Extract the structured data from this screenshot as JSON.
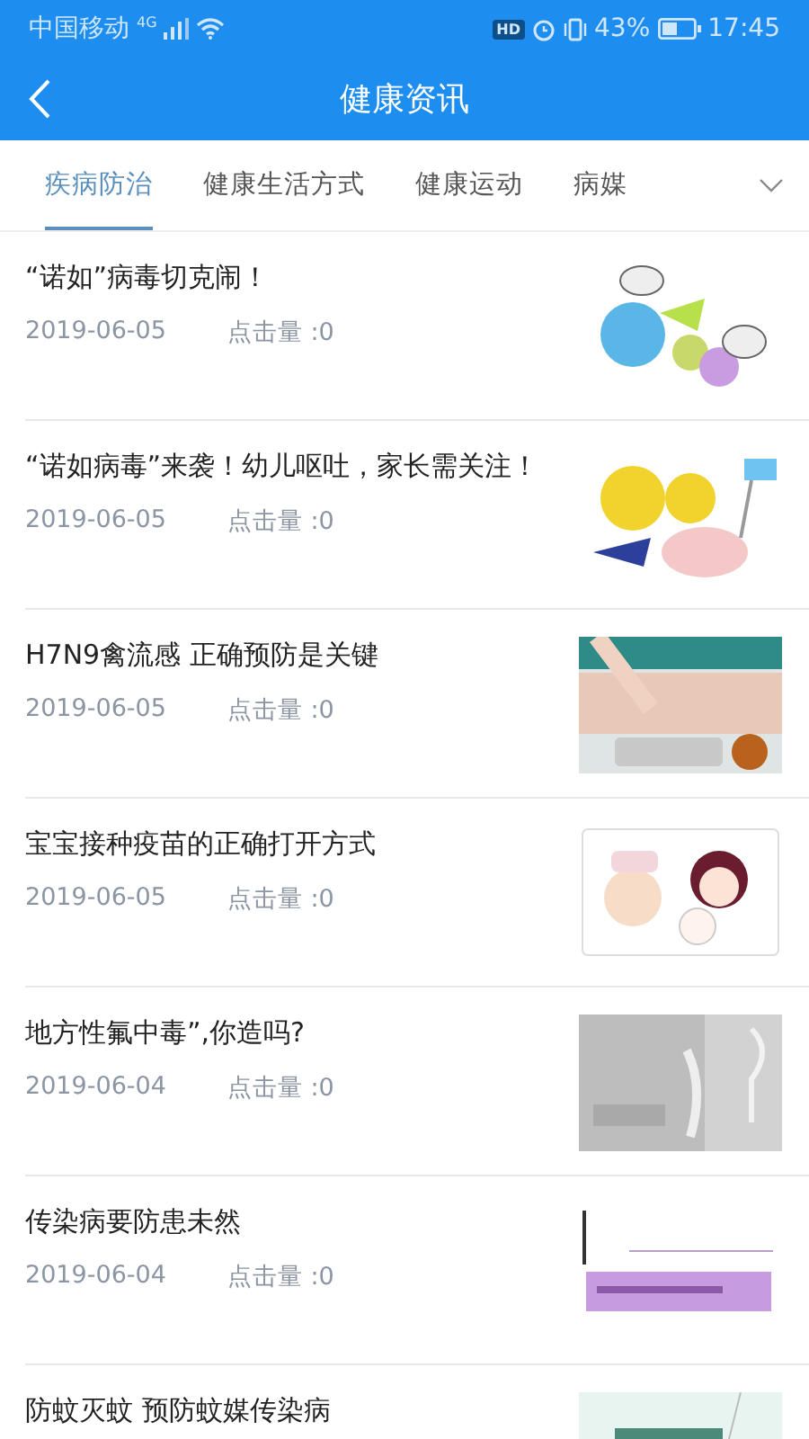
{
  "status_bar": {
    "carrier": "中国移动",
    "network": "4G",
    "hd_badge": "HD",
    "battery_text": "43%",
    "time": "17:45"
  },
  "nav_bar": {
    "title": "健康资讯"
  },
  "tabs": [
    {
      "label": "疾病防治",
      "selected": true
    },
    {
      "label": "健康生活方式",
      "selected": false
    },
    {
      "label": "健康运动",
      "selected": false
    },
    {
      "label": "病媒",
      "selected": false
    }
  ],
  "articles": [
    {
      "title": "“诺如”病毒切克闹！",
      "date": "2019-06-05",
      "clicks": "点击量 :0"
    },
    {
      "title": "“诺如病毒”来袭！幼儿呕吐，家长需关注！",
      "date": "2019-06-05",
      "clicks": "点击量 :0"
    },
    {
      "title": "H7N9禽流感 正确预防是关键",
      "date": "2019-06-05",
      "clicks": "点击量 :0"
    },
    {
      "title": "宝宝接种疫苗的正确打开方式",
      "date": "2019-06-05",
      "clicks": "点击量 :0"
    },
    {
      "title": "地方性氟中毒”,你造吗?",
      "date": "2019-06-04",
      "clicks": "点击量 :0"
    },
    {
      "title": "传染病要防患未然",
      "date": "2019-06-04",
      "clicks": "点击量 :0"
    },
    {
      "title": "防蚊灭蚊 预防蚊媒传染病"
    }
  ]
}
